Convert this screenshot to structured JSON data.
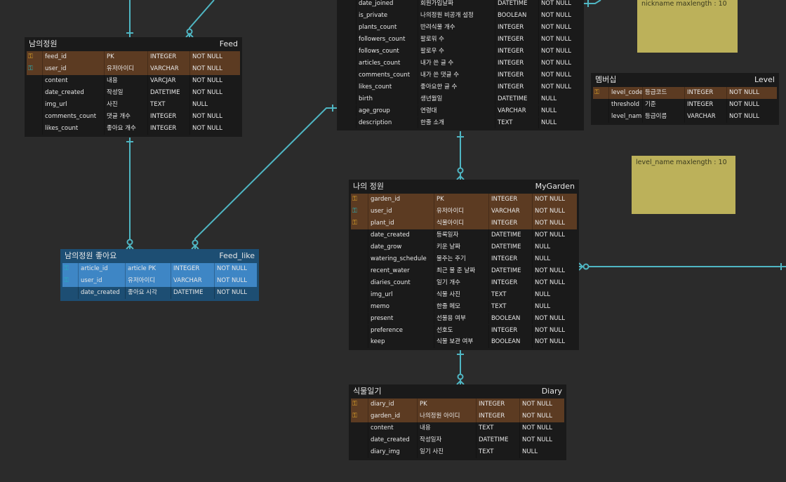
{
  "colors": {
    "background": "#2b2b2b",
    "table_bg": "#1a1a1a",
    "key_row": "#5c3b22",
    "selected_table": "#1d4e73",
    "selected_key_row": "#3e86c5",
    "edge": "#4fb6c3",
    "note": "#bcb15a",
    "pk_icon": "#e0a62a",
    "fk_icon": "#27b3bc"
  },
  "tables": {
    "feed": {
      "logical_name": "남의정원",
      "physical_name": "Feed",
      "rows": [
        {
          "key": "pk",
          "column": "feed_id",
          "logical": "PK",
          "type": "INTEGER",
          "null": "NOT NULL"
        },
        {
          "key": "fk",
          "column": "user_id",
          "logical": "유저아이디",
          "type": "VARCHAR",
          "null": "NOT NULL"
        },
        {
          "key": "",
          "column": "content",
          "logical": "내용",
          "type": "VARCJAR",
          "null": "NOT NULL"
        },
        {
          "key": "",
          "column": "date_created",
          "logical": "작성일",
          "type": "DATETIME",
          "null": "NOT NULL"
        },
        {
          "key": "",
          "column": "img_url",
          "logical": "사진",
          "type": "TEXT",
          "null": "NULL"
        },
        {
          "key": "",
          "column": "comments_count",
          "logical": "댓글 개수",
          "type": "INTEGER",
          "null": "NOT NULL"
        },
        {
          "key": "",
          "column": "likes_count",
          "logical": "좋아요 개수",
          "type": "INTEGER",
          "null": "NOT NULL"
        }
      ]
    },
    "feed_like": {
      "logical_name": "남의정원 좋아요",
      "physical_name": "Feed_like",
      "rows": [
        {
          "key": "fk",
          "column": "article_id",
          "logical": "article PK",
          "type": "INTEGER",
          "null": "NOT NULL"
        },
        {
          "key": "fk",
          "column": "user_id",
          "logical": "유저아이디",
          "type": "VARCHAR",
          "null": "NOT NULL"
        },
        {
          "key": "",
          "column": "date_created",
          "logical": "좋아요 시각",
          "type": "DATETIME",
          "null": "NOT NULL"
        }
      ]
    },
    "user": {
      "rows": [
        {
          "key": "",
          "column": "date_joined",
          "logical": "회원가입날짜",
          "type": "DATETIME",
          "null": "NOT NULL"
        },
        {
          "key": "",
          "column": "is_private",
          "logical": "나의정원 비공개 설정",
          "type": "BOOLEAN",
          "null": "NOT NULL"
        },
        {
          "key": "",
          "column": "plants_count",
          "logical": "반려식물 개수",
          "type": "INTEGER",
          "null": "NOT NULL"
        },
        {
          "key": "",
          "column": "followers_count",
          "logical": "팔로워 수",
          "type": "INTEGER",
          "null": "NOT NULL"
        },
        {
          "key": "",
          "column": "follows_count",
          "logical": "팔로우 수",
          "type": "INTEGER",
          "null": "NOT NULL"
        },
        {
          "key": "",
          "column": "articles_count",
          "logical": "내가 쓴 글 수",
          "type": "INTEGER",
          "null": "NOT NULL"
        },
        {
          "key": "",
          "column": "comments_count",
          "logical": "내가 쓴 댓글 수",
          "type": "INTEGER",
          "null": "NOT NULL"
        },
        {
          "key": "",
          "column": "likes_count",
          "logical": "좋아요한 글 수",
          "type": "INTEGER",
          "null": "NOT NULL"
        },
        {
          "key": "",
          "column": "birth",
          "logical": "생년월일",
          "type": "DATETIME",
          "null": "NULL"
        },
        {
          "key": "",
          "column": "age_group",
          "logical": "연령대",
          "type": "VARCHAR",
          "null": "NULL"
        },
        {
          "key": "",
          "column": "description",
          "logical": "한줄 소개",
          "type": "TEXT",
          "null": "NULL"
        }
      ]
    },
    "level": {
      "logical_name": "멤버십",
      "physical_name": "Level",
      "rows": [
        {
          "key": "pk",
          "column": "level_code",
          "logical": "등급코드",
          "type": "INTEGER",
          "null": "NOT NULL"
        },
        {
          "key": "",
          "column": "threshold",
          "logical": "기준",
          "type": "INTEGER",
          "null": "NOT NULL"
        },
        {
          "key": "",
          "column": "level_name",
          "logical": "등급이름",
          "type": "VARCHAR",
          "null": "NOT NULL"
        }
      ]
    },
    "mygarden": {
      "logical_name": "나의 정원",
      "physical_name": "MyGarden",
      "rows": [
        {
          "key": "pk",
          "column": "garden_id",
          "logical": "PK",
          "type": "INTEGER",
          "null": "NOT NULL"
        },
        {
          "key": "fk",
          "column": "user_id",
          "logical": "유저아이디",
          "type": "VARCHAR",
          "null": "NOT NULL"
        },
        {
          "key": "pk",
          "column": "plant_id",
          "logical": "식물아이디",
          "type": "INTEGER",
          "null": "NOT NULL"
        },
        {
          "key": "",
          "column": "date_created",
          "logical": "등록일자",
          "type": "DATETIME",
          "null": "NOT NULL"
        },
        {
          "key": "",
          "column": "date_grow",
          "logical": "키운 날짜",
          "type": "DATETIME",
          "null": "NULL"
        },
        {
          "key": "",
          "column": "watering_schedule",
          "logical": "물주는 주기",
          "type": "INTEGER",
          "null": "NULL"
        },
        {
          "key": "",
          "column": "recent_water",
          "logical": "최근 물 준 날짜",
          "type": "DATETIME",
          "null": "NOT NULL"
        },
        {
          "key": "",
          "column": "diaries_count",
          "logical": "일기 개수",
          "type": "INTEGER",
          "null": "NOT NULL"
        },
        {
          "key": "",
          "column": "img_url",
          "logical": "식물 사진",
          "type": "TEXT",
          "null": "NULL"
        },
        {
          "key": "",
          "column": "memo",
          "logical": "한줄 메모",
          "type": "TEXT",
          "null": "NULL"
        },
        {
          "key": "",
          "column": "present",
          "logical": "선물용 여부",
          "type": "BOOLEAN",
          "null": "NOT NULL"
        },
        {
          "key": "",
          "column": "preference",
          "logical": "선호도",
          "type": "INTEGER",
          "null": "NOT NULL"
        },
        {
          "key": "",
          "column": "keep",
          "logical": "식물 보관 여부",
          "type": "BOOLEAN",
          "null": "NOT NULL"
        }
      ]
    },
    "diary": {
      "logical_name": "식물일기",
      "physical_name": "Diary",
      "rows": [
        {
          "key": "pk",
          "column": "diary_id",
          "logical": "PK",
          "type": "INTEGER",
          "null": "NOT NULL"
        },
        {
          "key": "pk",
          "column": "garden_id",
          "logical": "나의정원 아이디",
          "type": "INTEGER",
          "null": "NOT NULL"
        },
        {
          "key": "",
          "column": "content",
          "logical": "내용",
          "type": "TEXT",
          "null": "NOT NULL"
        },
        {
          "key": "",
          "column": "date_created",
          "logical": "작성일자",
          "type": "DATETIME",
          "null": "NOT NULL"
        },
        {
          "key": "",
          "column": "diary_img",
          "logical": "일기 사진",
          "type": "TEXT",
          "null": "NULL"
        }
      ]
    }
  },
  "notes": {
    "nickname": "nickname maxlength : 10",
    "level_name": "level_name maxlength : 10"
  }
}
